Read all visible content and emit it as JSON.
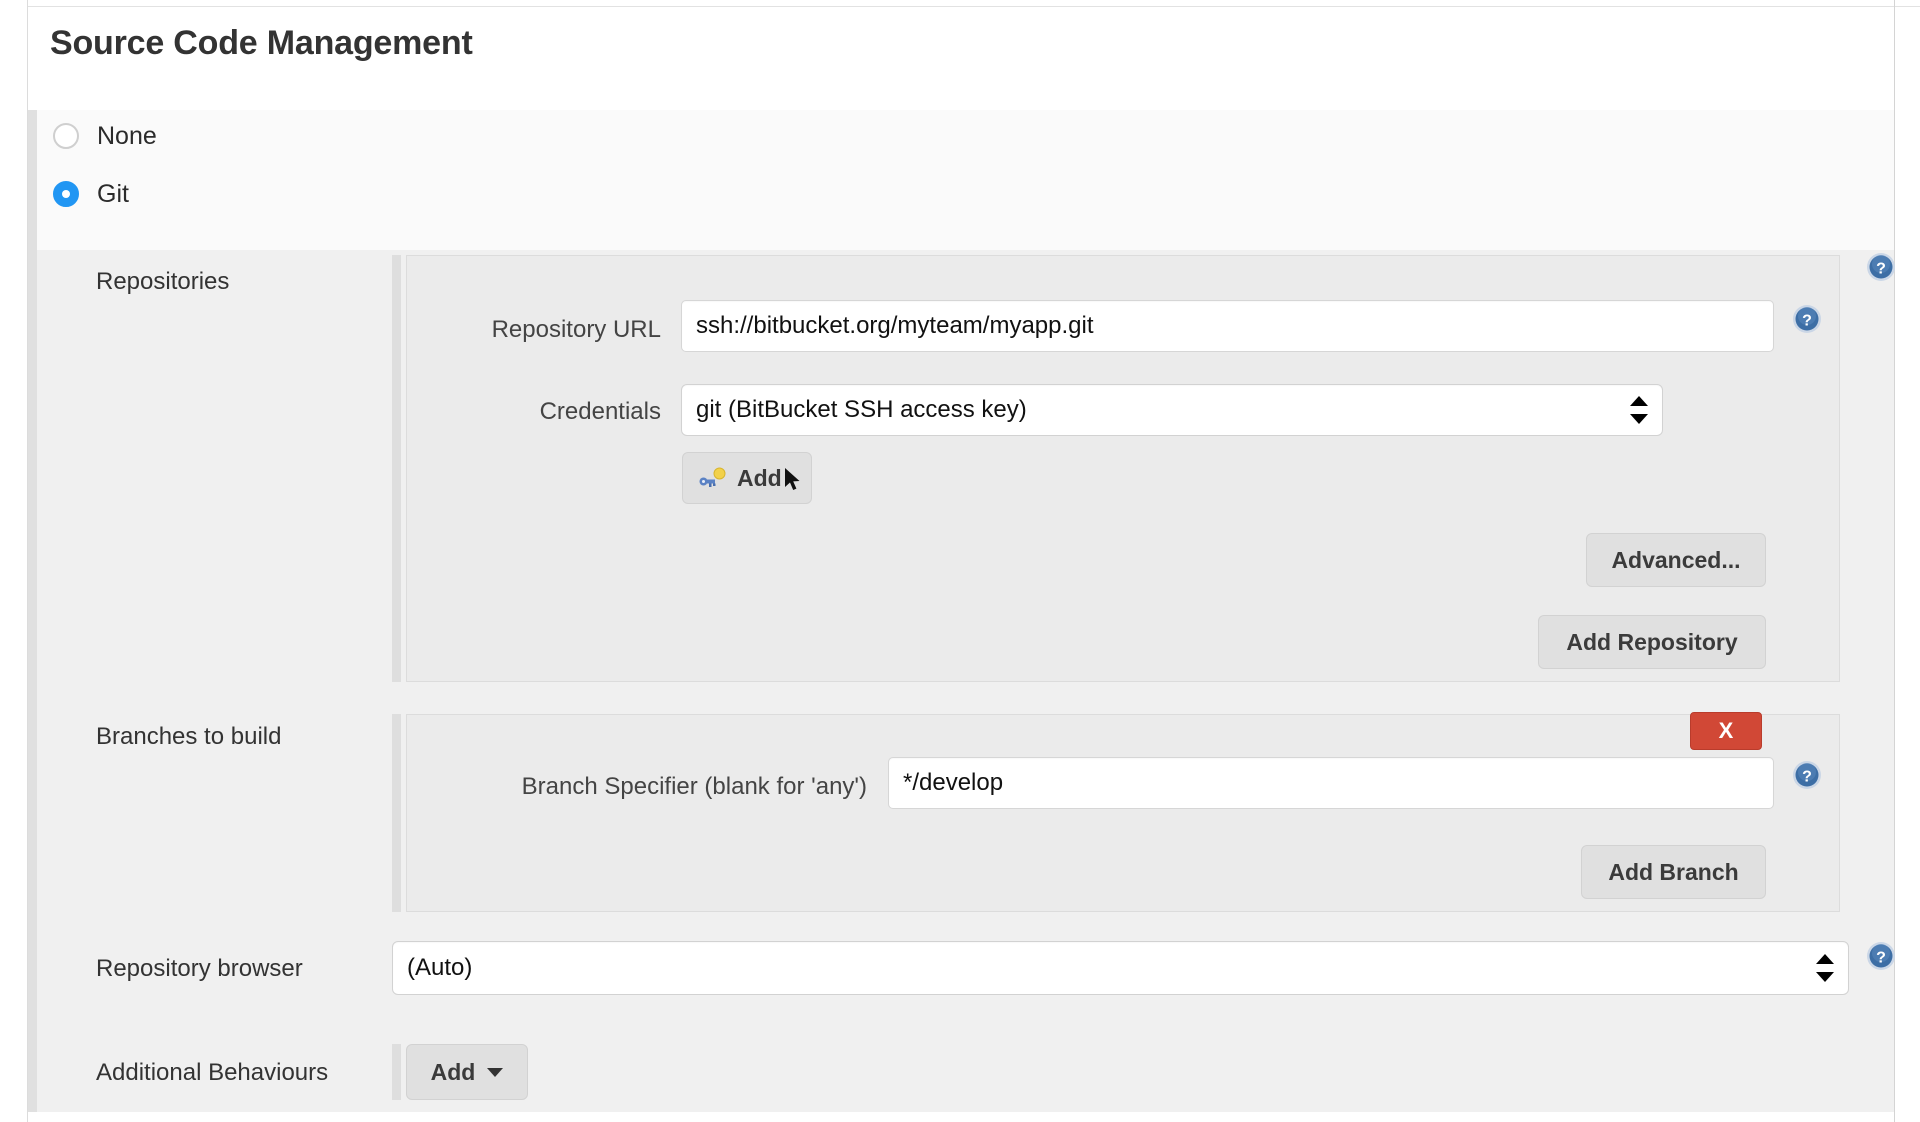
{
  "page": {
    "title": "Source Code Management"
  },
  "scm_choice": {
    "options": [
      {
        "label": "None",
        "selected": false
      },
      {
        "label": "Git",
        "selected": true
      }
    ]
  },
  "rows": {
    "repositories_label": "Repositories",
    "branches_label": "Branches to build",
    "repository_browser_label": "Repository browser",
    "additional_behaviours_label": "Additional Behaviours"
  },
  "repository": {
    "url_label": "Repository URL",
    "url_value": "ssh://bitbucket.org/myteam/myapp.git",
    "url_placeholder": "",
    "credentials_label": "Credentials",
    "credentials_value": "git (BitBucket SSH access key)",
    "add_credentials_label": "Add",
    "advanced_label": "Advanced...",
    "add_repository_label": "Add Repository"
  },
  "branch": {
    "specifier_label": "Branch Specifier (blank for 'any')",
    "specifier_value": "*/develop",
    "specifier_placeholder": "",
    "delete_label": "X",
    "add_branch_label": "Add Branch"
  },
  "repository_browser": {
    "value": "(Auto)"
  },
  "additional_behaviours": {
    "add_label": "Add"
  },
  "icons": {
    "help": "help-icon",
    "key": "credentials-key-icon",
    "caret": "chevron-down-icon",
    "cursor": "mouse-pointer-icon"
  },
  "colors": {
    "accent_radio": "#2196f3",
    "delete_button": "#d14836",
    "help_icon": "#3d6ea5",
    "body_background": "#f0f0f0",
    "block_background": "#ebebeb"
  }
}
